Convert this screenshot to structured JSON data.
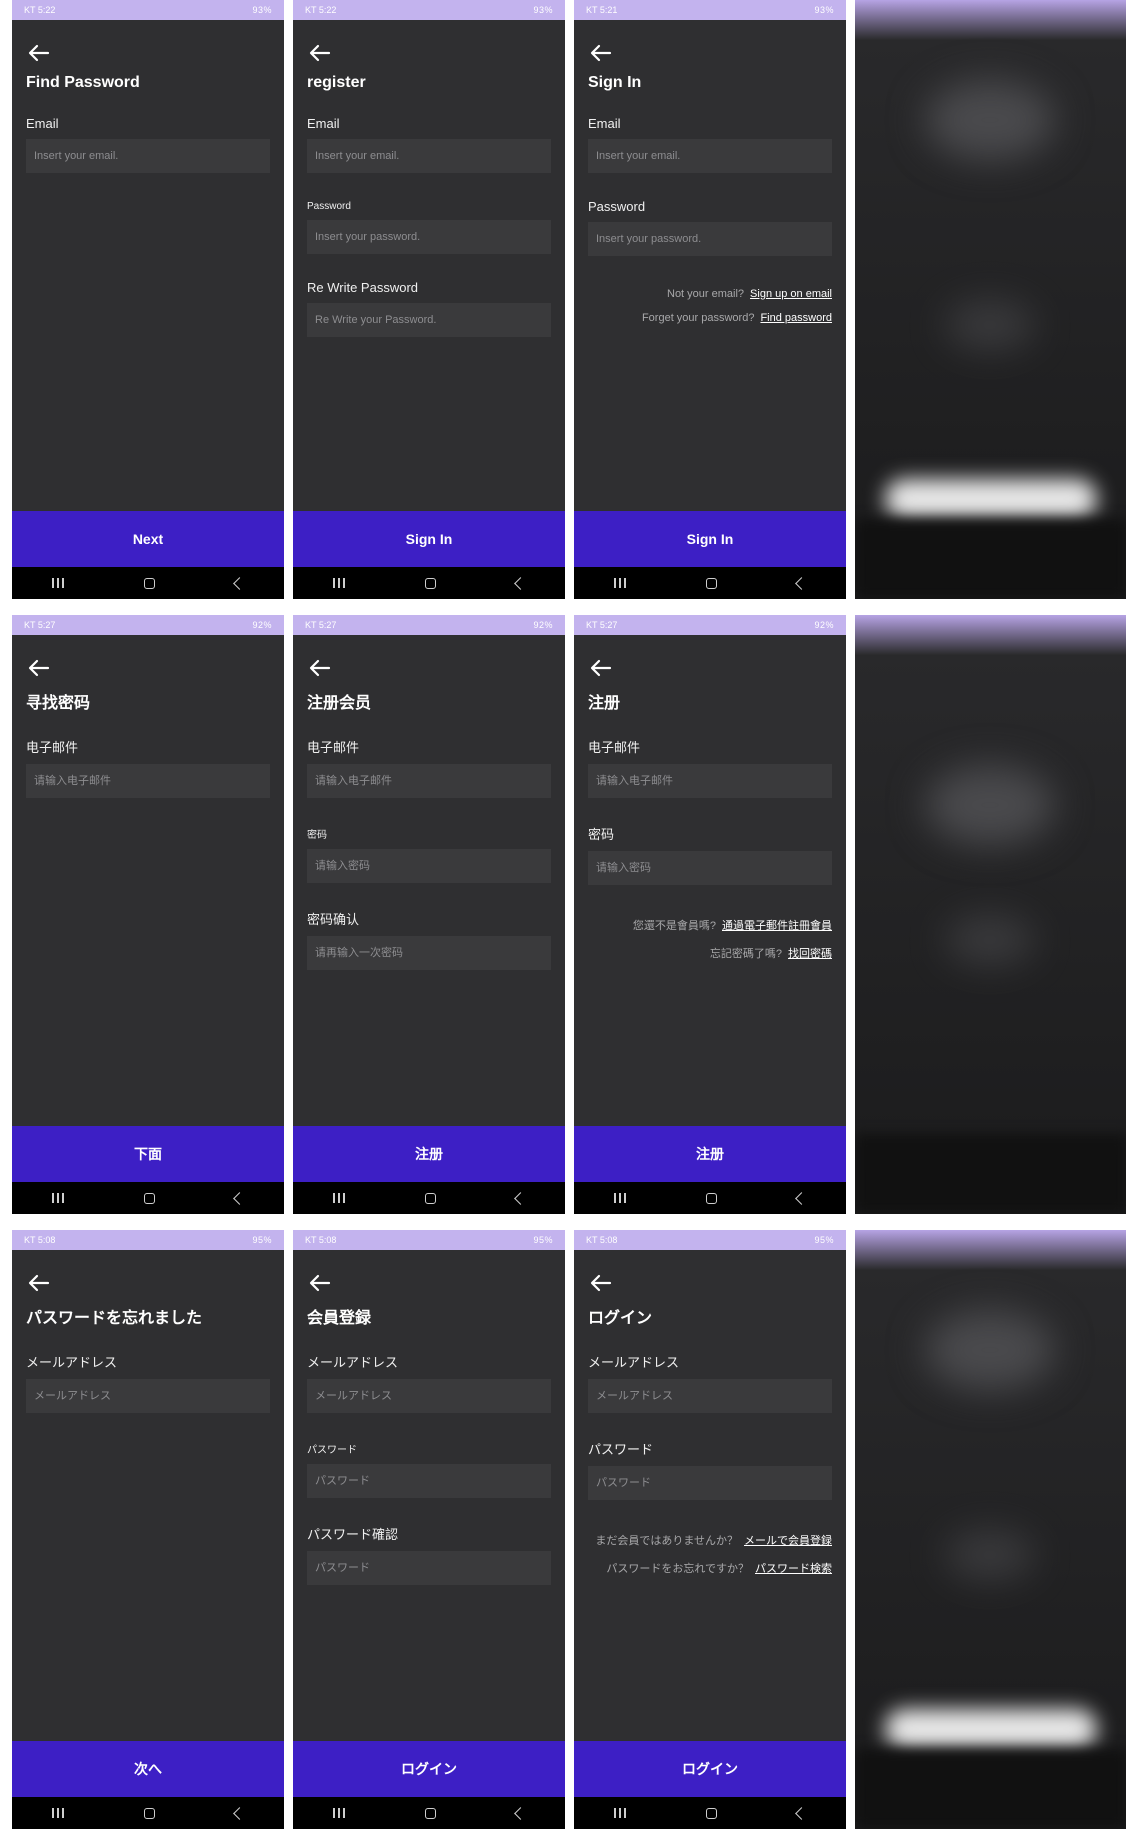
{
  "screens": [
    {
      "status_time": "KT 5:22",
      "status_right": "93%",
      "title": "Find Password",
      "fields": [
        {
          "label": "Email",
          "placeholder": "Insert your email."
        }
      ],
      "links": [],
      "action": "Next"
    },
    {
      "status_time": "KT 5:22",
      "status_right": "93%",
      "title": "register",
      "fields": [
        {
          "label": "Email",
          "placeholder": "Insert your email."
        },
        {
          "label": "Password",
          "placeholder": "Insert your password.",
          "small": true
        },
        {
          "label": "Re Write Password",
          "placeholder": "Re Write your Password."
        }
      ],
      "links": [],
      "action": "Sign In"
    },
    {
      "status_time": "KT 5:21",
      "status_right": "93%",
      "title": "Sign In",
      "fields": [
        {
          "label": "Email",
          "placeholder": "Insert your email."
        },
        {
          "label": "Password",
          "placeholder": "Insert your password."
        }
      ],
      "links": [
        {
          "text": "Not your email?",
          "link": "Sign up on email"
        },
        {
          "text": "Forget your password?",
          "link": "Find password"
        }
      ],
      "action": "Sign In"
    },
    {
      "status_time": "KT 5:27",
      "status_right": "92%",
      "title": "寻找密码",
      "fields": [
        {
          "label": "电子邮件",
          "placeholder": "请输入电子邮件"
        }
      ],
      "links": [],
      "action": "下面"
    },
    {
      "status_time": "KT 5:27",
      "status_right": "92%",
      "title": "注册会员",
      "fields": [
        {
          "label": "电子邮件",
          "placeholder": "请输入电子邮件"
        },
        {
          "label": "密码",
          "placeholder": "请输入密码",
          "small": true
        },
        {
          "label": "密码确认",
          "placeholder": "请再输入一次密码"
        }
      ],
      "links": [],
      "action": "注册"
    },
    {
      "status_time": "KT 5:27",
      "status_right": "92%",
      "title": "注册",
      "fields": [
        {
          "label": "电子邮件",
          "placeholder": "请输入电子邮件"
        },
        {
          "label": "密码",
          "placeholder": "请输入密码"
        }
      ],
      "links": [
        {
          "text": "您還不是會員嗎?",
          "link": "通過電子郵件註冊會員"
        },
        {
          "text": "忘記密碼了嗎?",
          "link": "找回密碼"
        }
      ],
      "action": "注册"
    },
    {
      "status_time": "KT 5:08",
      "status_right": "95%",
      "title": "パスワードを忘れました",
      "fields": [
        {
          "label": "メールアドレス",
          "placeholder": "メールアドレス"
        }
      ],
      "links": [],
      "action": "次へ"
    },
    {
      "status_time": "KT 5:08",
      "status_right": "95%",
      "title": "会員登録",
      "fields": [
        {
          "label": "メールアドレス",
          "placeholder": "メールアドレス"
        },
        {
          "label": "パスワード",
          "placeholder": "パスワード",
          "small": true
        },
        {
          "label": "パスワード確認",
          "placeholder": "パスワード"
        }
      ],
      "links": [],
      "action": "ログイン"
    },
    {
      "status_time": "KT 5:08",
      "status_right": "95%",
      "title": "ログイン",
      "fields": [
        {
          "label": "メールアドレス",
          "placeholder": "メールアドレス"
        },
        {
          "label": "パスワード",
          "placeholder": "パスワード"
        }
      ],
      "links": [
        {
          "text": "まだ会員ではありませんか？",
          "link": "メールで会員登録"
        },
        {
          "text": "パスワードをお忘れですか？",
          "link": "パスワード検索"
        }
      ],
      "action": "ログイン"
    }
  ],
  "icons": {
    "back": "arrow-left-icon",
    "nav_recent": "recent-apps-icon",
    "nav_home": "home-icon",
    "nav_back": "chevron-left-icon"
  },
  "colors": {
    "status_bar": "#c3b3ee",
    "screen_bg": "#2f2f31",
    "input_bg": "#3a3a3c",
    "primary_button": "#3d1fc5",
    "nav_bar": "#000000"
  }
}
